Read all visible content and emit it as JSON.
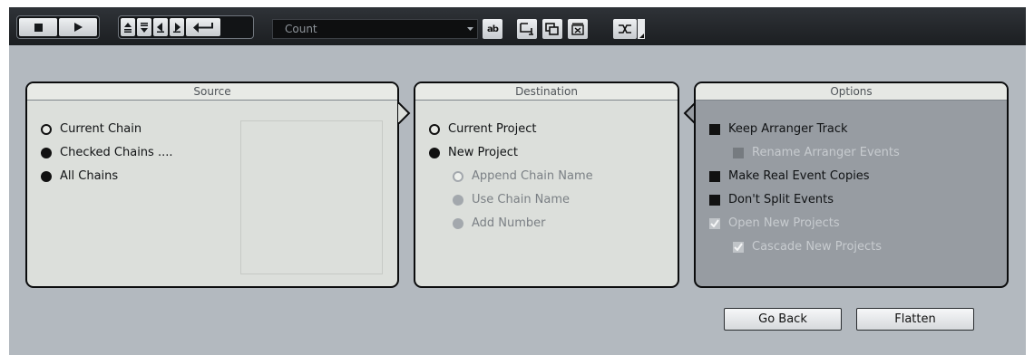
{
  "toolbar": {
    "transport": [
      {
        "name": "stop-icon"
      },
      {
        "name": "play-icon"
      }
    ],
    "navigation": [
      {
        "name": "move-up-icon"
      },
      {
        "name": "move-down-icon"
      },
      {
        "name": "prev-icon"
      },
      {
        "name": "next-icon"
      },
      {
        "name": "return-arrow-icon"
      }
    ],
    "count_combo": {
      "value": "Count"
    },
    "rename_icon_label": "ab"
  },
  "source": {
    "title": "Source",
    "options": [
      {
        "label": "Current Chain",
        "selected": false
      },
      {
        "label": "Checked Chains ....",
        "selected": true
      },
      {
        "label": "All Chains",
        "selected": true
      }
    ]
  },
  "destination": {
    "title": "Destination",
    "options": [
      {
        "label": "Current Project",
        "selected": false
      },
      {
        "label": "New Project",
        "selected": true
      }
    ],
    "sub_options": [
      {
        "label": "Append Chain Name",
        "enabled": false
      },
      {
        "label": "Use Chain Name",
        "enabled": false
      },
      {
        "label": "Add Number",
        "enabled": false
      }
    ]
  },
  "options": {
    "title": "Options",
    "items": [
      {
        "label": "Keep Arranger Track",
        "checked": true,
        "enabled": true
      },
      {
        "label": "Rename Arranger Events",
        "checked": true,
        "enabled": false
      },
      {
        "label": "Make Real Event Copies",
        "checked": true,
        "enabled": true
      },
      {
        "label": "Don't Split Events",
        "checked": true,
        "enabled": true
      },
      {
        "label": "Open New Projects",
        "checked": true,
        "enabled": false
      },
      {
        "label": "Cascade New Projects",
        "checked": true,
        "enabled": false
      }
    ]
  },
  "buttons": {
    "go_back": "Go Back",
    "flatten": "Flatten"
  },
  "colors": {
    "window_bg": "#b3b9bf",
    "toolbar_bg": "#25282c",
    "panel_bg": "#dcdfdb",
    "options_bg": "#979ca2"
  }
}
